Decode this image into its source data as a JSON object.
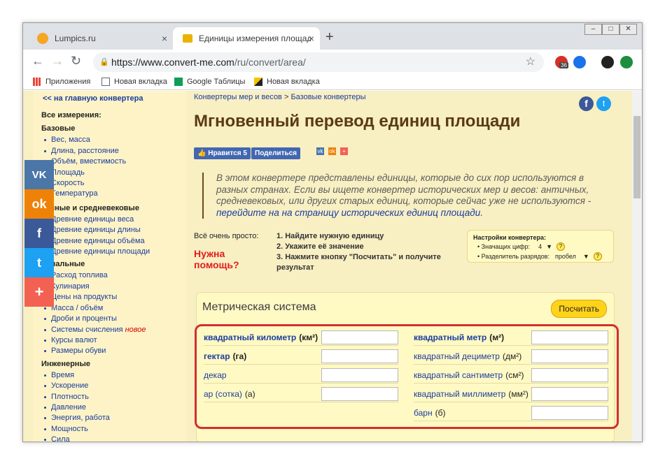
{
  "tabs": [
    {
      "title": "Lumpics.ru",
      "close": "×"
    },
    {
      "title": "Единицы измерения площади. ",
      "close": "×"
    }
  ],
  "new_tab": "+",
  "window_buttons": {
    "minimize": "–",
    "maximize": "□",
    "close": "✕"
  },
  "nav": {
    "back": "←",
    "forward": "→",
    "reload": "↻"
  },
  "omnibox": {
    "lock": "🔒",
    "url_prefix": "https://www.convert-me.com",
    "url_path": "/ru/convert/area/"
  },
  "toolbar_icons": {
    "star": "☆",
    "badge": "36",
    "menu": "⋮"
  },
  "bookmarks": [
    {
      "label": "Приложения",
      "icon": "apps-grid-icon"
    },
    {
      "label": "Новая вкладка",
      "icon": "page-icon"
    },
    {
      "label": "Google Таблицы",
      "icon": "sheets-icon"
    },
    {
      "label": "Новая вкладка",
      "icon": "image-icon"
    }
  ],
  "sidebar": {
    "back_link": "<< на главную конвертера",
    "all_label": "Все измерения:",
    "groups": [
      {
        "title": "Базовые",
        "items": [
          "Вес, масса",
          "Длина, расстояние",
          "Объём, вместимость",
          "Площадь",
          "Скорость",
          "Температура"
        ]
      },
      {
        "title": "Античные и средневековые",
        "items": [
          "Древние единицы веса",
          "Древние единицы длины",
          "Древние единицы объёма",
          "Древние единицы площади"
        ]
      },
      {
        "title": "Специальные",
        "items": [
          "Расход топлива",
          "Кулинария",
          "Цены на продукты",
          "Масса / объём",
          "Дроби и проценты",
          "Системы счисления",
          "Курсы валют",
          "Размеры обуви"
        ]
      },
      {
        "title": "Инженерные",
        "items": [
          "Время",
          "Ускорение",
          "Плотность",
          "Давление",
          "Энергия, работа",
          "Мощность",
          "Сила"
        ]
      }
    ],
    "new_badge": "новое"
  },
  "social_share": [
    {
      "label": "VK",
      "color": "#4a76a8"
    },
    {
      "label": "ok",
      "color": "#ee8208"
    },
    {
      "label": "f",
      "color": "#3b5998"
    },
    {
      "label": "t",
      "color": "#1da1f2"
    },
    {
      "label": "+",
      "color": "#f26152"
    }
  ],
  "breadcrumb": {
    "part1": "Конвертеры мер и весов",
    "sep": " > ",
    "part2": "Базовые конвертеры"
  },
  "page_title": "Мгновенный перевод единиц площади",
  "like_button": "👍 Нравится 5",
  "share_button": "Поделиться",
  "intro": {
    "text": "В этом конвертере представлены единицы, которые до сих пор используются в разных странах. Если вы ищете конвертер исторических мер и весов: античных, средневековых, или других старых единиц, которые сейчас уже не используются - ",
    "link": "перейдите на на страницу исторических единиц площади."
  },
  "simple_label": "Всё очень просто:",
  "help_label": "Нужна помощь?",
  "steps": [
    "1. Найдите нужную единицу",
    "2. Укажите её значение",
    "3. Нажмите кнопку \"Посчитать\" и получите результат"
  ],
  "settings": {
    "title": "Настройки конвертера:",
    "digits_label": "Значащих цифр:",
    "digits_value": "4",
    "separator_label": "Разделитель разрядов:",
    "separator_value": "пробел",
    "help_mark": "?"
  },
  "metric": {
    "title": "Метрическая система",
    "calc_button": "Посчитать",
    "left_units": [
      {
        "name": "квадратный километр",
        "symbol": "(км²)",
        "bold": true
      },
      {
        "name": "гектар",
        "symbol": "(га)",
        "bold": true
      },
      {
        "name": "декар",
        "symbol": "",
        "bold": false
      },
      {
        "name": "ар (сотка)",
        "symbol": "(а)",
        "bold": false
      }
    ],
    "right_units": [
      {
        "name": "квадратный метр",
        "symbol": "(м²)",
        "bold": true
      },
      {
        "name": "квадратный дециметр",
        "symbol": "(дм²)",
        "bold": false
      },
      {
        "name": "квадратный сантиметр",
        "symbol": "(см²)",
        "bold": false
      },
      {
        "name": "квадратный миллиметр",
        "symbol": "(мм²)",
        "bold": false
      },
      {
        "name": "барн",
        "symbol": "(б)",
        "bold": false
      }
    ]
  }
}
